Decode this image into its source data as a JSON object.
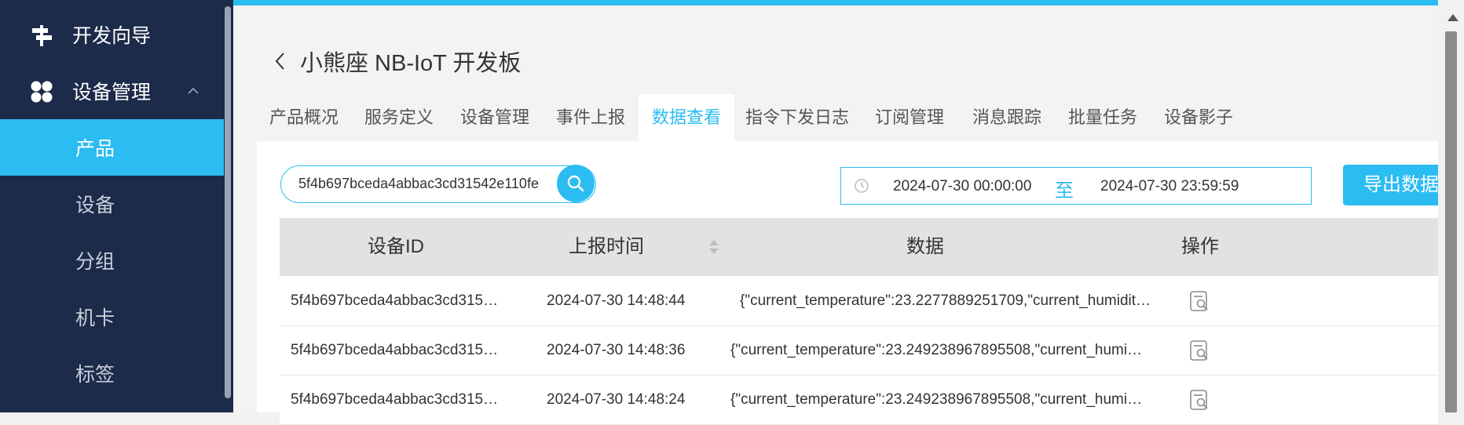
{
  "sidebar": {
    "items": [
      {
        "label": "开发向导",
        "icon": "signpost-icon"
      },
      {
        "label": "设备管理",
        "icon": "grid-icon",
        "expanded": true
      }
    ],
    "sub_items": [
      {
        "label": "产品",
        "active": true
      },
      {
        "label": "设备"
      },
      {
        "label": "分组"
      },
      {
        "label": "机卡"
      },
      {
        "label": "标签"
      }
    ]
  },
  "colors": {
    "accent": "#2bbcf2",
    "sidebar_bg": "#1d2b4a",
    "header_bg": "#e2e2e2"
  },
  "page": {
    "back_icon": "chevron-left-icon",
    "title": "小熊座 NB-IoT 开发板"
  },
  "tabs": [
    {
      "label": "产品概况"
    },
    {
      "label": "服务定义"
    },
    {
      "label": "设备管理"
    },
    {
      "label": "事件上报"
    },
    {
      "label": "数据查看",
      "active": true
    },
    {
      "label": "指令下发日志"
    },
    {
      "label": "订阅管理"
    },
    {
      "label": "消息跟踪"
    },
    {
      "label": "批量任务"
    },
    {
      "label": "设备影子"
    }
  ],
  "search": {
    "value": "5f4b697bceda4abbac3cd31542e110fe"
  },
  "date_range": {
    "start": "2024-07-30 00:00:00",
    "separator": "至",
    "end": "2024-07-30 23:59:59"
  },
  "export_button": {
    "label": "导出数据"
  },
  "table": {
    "columns": [
      "设备ID",
      "上报时间",
      "数据",
      "操作"
    ],
    "rows": [
      {
        "device_id": "5f4b697bceda4abbac3cd315…",
        "time": "2024-07-30 14:48:44",
        "data": "{\"current_temperature\":23.2277889251709,\"current_humidit…"
      },
      {
        "device_id": "5f4b697bceda4abbac3cd315…",
        "time": "2024-07-30 14:48:36",
        "data": "{\"current_temperature\":23.249238967895508,\"current_humi…"
      },
      {
        "device_id": "5f4b697bceda4abbac3cd315…",
        "time": "2024-07-30 14:48:24",
        "data": "{\"current_temperature\":23.249238967895508,\"current_humi…"
      }
    ]
  }
}
